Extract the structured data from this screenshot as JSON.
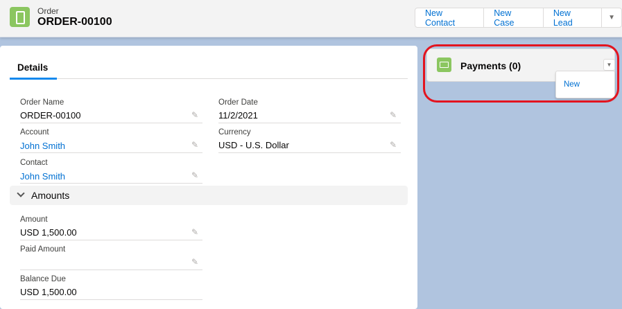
{
  "header": {
    "object_type": "Order",
    "record_name": "ORDER-00100",
    "actions": [
      "New Contact",
      "New Case",
      "New Lead"
    ],
    "more_icon": "chevron-down-icon"
  },
  "tabs": {
    "active": "Details"
  },
  "fields": {
    "order_name": {
      "label": "Order Name",
      "value": "ORDER-00100"
    },
    "order_date": {
      "label": "Order Date",
      "value": "11/2/2021"
    },
    "account": {
      "label": "Account",
      "value": "John Smith"
    },
    "currency": {
      "label": "Currency",
      "value": "USD - U.S. Dollar"
    },
    "contact": {
      "label": "Contact",
      "value": "John Smith"
    }
  },
  "amounts_section": {
    "title": "Amounts",
    "amount": {
      "label": "Amount",
      "value": "USD 1,500.00"
    },
    "paid_amount": {
      "label": "Paid Amount",
      "value": ""
    },
    "balance_due": {
      "label": "Balance Due",
      "value": "USD 1,500.00"
    }
  },
  "related": {
    "title": "Payments (0)",
    "menu_items": [
      "New"
    ]
  },
  "colors": {
    "accent": "#0070d2",
    "highlight": "#e3141f",
    "icon": "#8bc660"
  }
}
